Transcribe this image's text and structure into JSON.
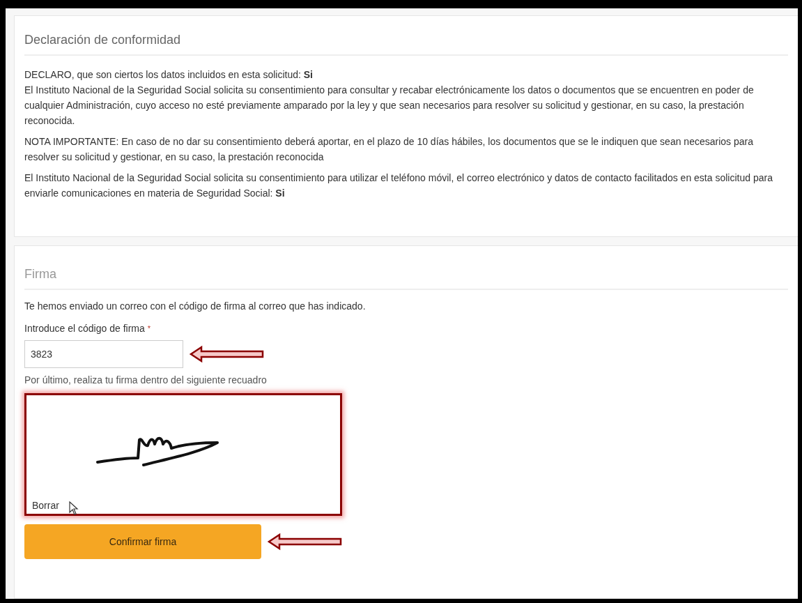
{
  "declaration": {
    "title": "Declaración de conformidad",
    "paragraphs": [
      {
        "lines": [
          "DECLARO, que son ciertos los datos incluidos en esta solicitud: **Si**",
          "El Instituto Nacional de la Seguridad Social solicita su consentimiento para consultar y recabar electrónicamente los datos o documentos que se encuentren en poder de cualquier Administración, cuyo acceso no esté previamente amparado por la ley y que sean necesarios para resolver su solicitud y gestionar, en su caso, la prestación reconocida."
        ]
      },
      {
        "lines": [
          "NOTA IMPORTANTE: En caso de no dar su consentimiento deberá aportar, en el plazo de 10 días hábiles, los documentos que se le indiquen que sean necesarios para resolver su solicitud y gestionar, en su caso, la prestación reconocida"
        ]
      },
      {
        "lines": [
          "El Instituto Nacional de la Seguridad Social solicita su consentimiento para utilizar el teléfono móvil, el correo electrónico y datos de contacto facilitados en esta solicitud para enviarle comunicaciones en materia de Seguridad Social: **Si**"
        ]
      }
    ]
  },
  "signature": {
    "title": "Firma",
    "notice": "Te hemos enviado un correo con el código de firma al correo que has indicado.",
    "code_field": {
      "label": "Introduce el código de firma",
      "required_mark": "*",
      "value": "3823",
      "highlighted": true
    },
    "instruction": "Por último, realiza tu firma dentro del siguiente recuadro",
    "pad": {
      "highlighted": true,
      "clear_link": "Borrar"
    },
    "confirm_button": {
      "label": "Confirmar firma",
      "highlighted": true
    }
  }
}
